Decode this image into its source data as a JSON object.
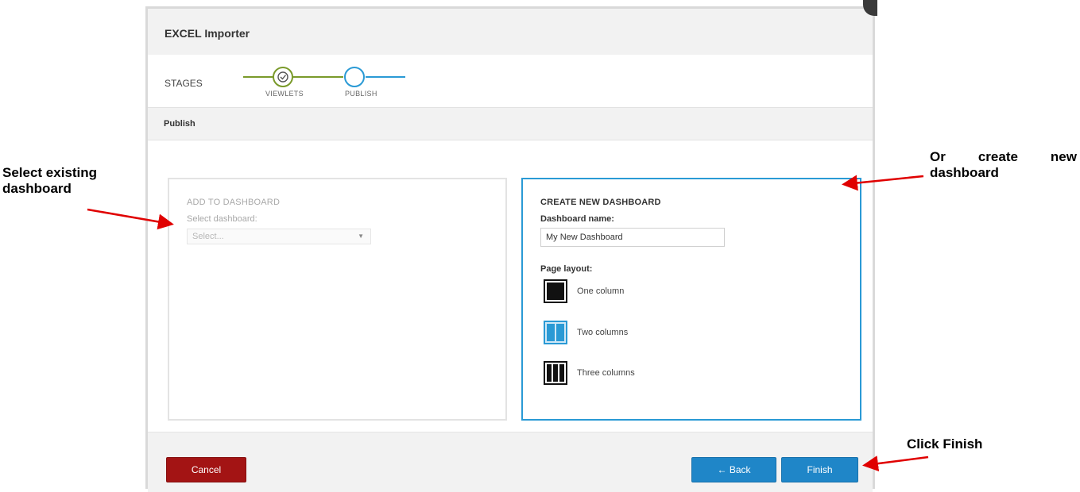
{
  "dialog": {
    "title": "EXCEL Importer",
    "stages": {
      "label": "STAGES",
      "items": [
        {
          "name": "VIEWLETS",
          "status": "complete"
        },
        {
          "name": "PUBLISH",
          "status": "current"
        }
      ]
    },
    "section_title": "Publish"
  },
  "add_panel": {
    "heading": "ADD TO DASHBOARD",
    "field_label": "Select dashboard:",
    "select_placeholder": "Select...",
    "caret": "▼"
  },
  "create_panel": {
    "heading": "CREATE NEW DASHBOARD",
    "name_label": "Dashboard name:",
    "name_value": "My New Dashboard",
    "layout_label": "Page layout:",
    "layouts": [
      {
        "label": "One column",
        "icon": "one-column-layout-icon",
        "selected": false
      },
      {
        "label": "Two columns",
        "icon": "two-columns-layout-icon",
        "selected": true
      },
      {
        "label": "Three columns",
        "icon": "three-columns-layout-icon",
        "selected": false
      }
    ]
  },
  "footer": {
    "cancel_label": "Cancel",
    "back_label": "← Back",
    "finish_label": "Finish"
  },
  "annotations": {
    "left_line1": "Select existing",
    "left_line2": "dashboard",
    "right_line1": "Or create new",
    "right_line2": "dashboard",
    "bottom": "Click Finish"
  },
  "colors": {
    "accent_blue": "#2a9ad5",
    "stage_green": "#7a9a2a",
    "button_blue": "#1f86c8",
    "cancel_red": "#a31414",
    "arrow_red": "#e00000"
  }
}
